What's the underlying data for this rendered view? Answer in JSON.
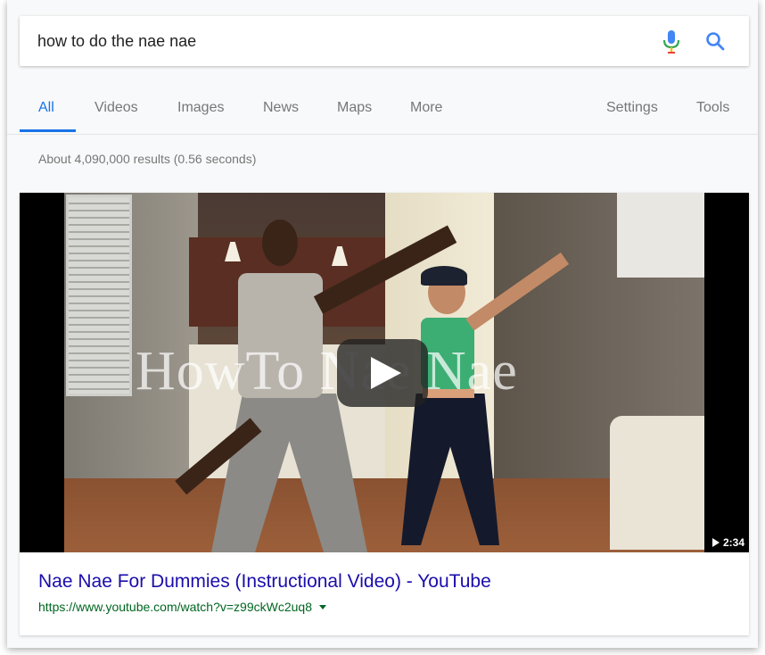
{
  "search": {
    "query": "how to do the nae nae",
    "icons": {
      "mic": "microphone-icon",
      "search": "search-icon"
    }
  },
  "tabs": {
    "items": [
      {
        "label": "All",
        "active": true
      },
      {
        "label": "Videos"
      },
      {
        "label": "Images"
      },
      {
        "label": "News"
      },
      {
        "label": "Maps"
      },
      {
        "label": "More"
      }
    ],
    "settings": "Settings",
    "tools": "Tools"
  },
  "stats": "About 4,090,000 results (0.56 seconds)",
  "result": {
    "video_overlay_title": "HowTo Nae Nae",
    "duration": "2:34",
    "title": "Nae Nae For Dummies (Instructional Video) - YouTube",
    "url": "https://www.youtube.com/watch?v=z99ckWc2uq8"
  },
  "colors": {
    "accent": "#1a73e8",
    "link": "#1a0dab",
    "url": "#006621",
    "muted": "#777777"
  }
}
